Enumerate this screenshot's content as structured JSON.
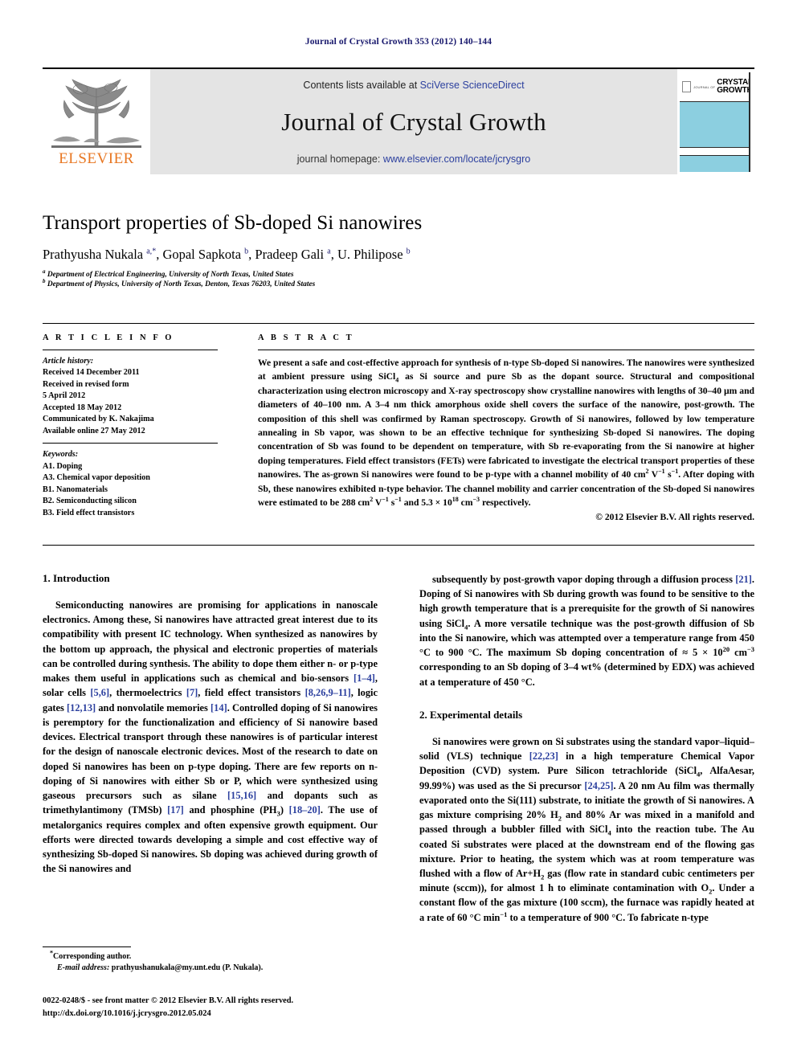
{
  "running_head": "Journal of Crystal Growth 353 (2012) 140–144",
  "masthead": {
    "publisher_logo_text": "ELSEVIER",
    "contents_prefix": "Contents lists available at ",
    "contents_link": "SciVerse ScienceDirect",
    "journal_title": "Journal of Crystal Growth",
    "homepage_prefix": "journal homepage: ",
    "homepage_link": "www.elsevier.com/locate/jcrysgro",
    "cover": {
      "journal_of": "JOURNAL OF",
      "line1": "CRYSTAL",
      "line2": "GROWTH"
    }
  },
  "article": {
    "title": "Transport properties of Sb-doped Si nanowires",
    "authors_html": "Prathyusha Nukala <sup>a,</sup><sup>*</sup>, Gopal Sapkota <sup>b</sup>, Pradeep Gali <sup>a</sup>, U. Philipose <sup>b</sup>",
    "affiliation_a": "Department of Electrical Engineering, University of North Texas, United States",
    "affiliation_b": "Department of Physics, University of North Texas, Denton, Texas 76203, United States"
  },
  "article_info": {
    "heading": "A R T I C L E   I N F O",
    "history_label": "Article history:",
    "history": [
      "Received 14 December 2011",
      "Received in revised form",
      "5 April 2012",
      "Accepted 18 May 2012",
      "Communicated by K. Nakajima",
      "Available online 27 May 2012"
    ],
    "keywords_label": "Keywords:",
    "keywords": [
      "A1. Doping",
      "A3. Chemical vapor deposition",
      "B1. Nanomaterials",
      "B2. Semiconducting silicon",
      "B3. Field effect transistors"
    ]
  },
  "abstract": {
    "heading": "A B S T R A C T",
    "text_html": "We present a safe and cost-effective approach for synthesis of n-type Sb-doped Si nanowires. The nanowires were synthesized at ambient pressure using SiCl<sub>4</sub> as Si source and pure Sb as the dopant source. Structural and compositional characterization using electron microscopy and X-ray spectroscopy show crystalline nanowires with lengths of 30&#8211;40 &#181;m and diameters of 40&#8211;100 nm. A 3&#8211;4 nm thick amorphous oxide shell covers the surface of the nanowire, post-growth. The composition of this shell was confirmed by Raman spectroscopy. Growth of Si nanowires, followed by low temperature annealing in Sb vapor, was shown to be an effective technique for synthesizing Sb-doped Si nanowires. The doping concentration of Sb was found to be dependent on temperature, with Sb re-evaporating from the Si nanowire at higher doping temperatures. Field effect transistors (FETs) were fabricated to investigate the electrical transport properties of these nanowires. The as-grown Si nanowires were found to be p-type with a channel mobility of 40 cm<sup>2</sup> V<sup>&#8722;1</sup> s<sup>&#8722;1</sup>. After doping with Sb, these nanowires exhibited n-type behavior. The channel mobility and carrier concentration of the Sb-doped Si nanowires were estimated to be 288 cm<sup>2</sup> V<sup>&#8722;1</sup> s<sup>&#8722;1</sup> and 5.3 &#215; 10<sup>18</sup> cm<sup>&#8722;3</sup> respectively.",
    "copyright": "&#169; 2012 Elsevier B.V. All rights reserved."
  },
  "sections": {
    "introduction": {
      "heading": "1.  Introduction",
      "paragraph_html": "Semiconducting nanowires are promising for applications in nanoscale electronics. Among these, Si nanowires have attracted great interest due to its compatibility with present IC technology. When synthesized as nanowires by the bottom up approach, the physical and electronic properties of materials can be controlled during synthesis. The ability to dope them either n- or p-type makes them useful in applications such as chemical and bio-sensors <span class=\"ref\">[1&#8211;4]</span>, solar cells <span class=\"ref\">[5,6]</span>, thermoelectrics <span class=\"ref\">[7]</span>, field effect transistors <span class=\"ref\">[8,26,9&#8211;11]</span>, logic gates <span class=\"ref\">[12,13]</span> and nonvolatile memories <span class=\"ref\">[14]</span>. Controlled doping of Si nanowires is peremptory for the functionalization and efficiency of Si nanowire based devices. Electrical transport through these nanowires is of particular interest for the design of nanoscale electronic devices. Most of the research to date on doped Si nanowires has been on p-type doping. There are few reports on n-doping of Si nanowires with either Sb or P, which were synthesized using gaseous precursors such as silane <span class=\"ref\">[15,16]</span> and dopants such as trimethylantimony (TMSb) <span class=\"ref\">[17]</span> and phosphine (PH<sub>3</sub>) <span class=\"ref\">[18&#8211;20]</span>. The use of metalorganics requires complex and often expensive growth equipment. Our efforts were directed towards developing a simple and cost effective way of synthesizing Sb-doped Si nanowires. Sb doping was achieved during growth of the Si nanowires and"
    },
    "introduction_cont": {
      "paragraph_html": "subsequently by post-growth vapor doping through a diffusion process <span class=\"ref\">[21]</span>. Doping of Si nanowires with Sb during growth was found to be sensitive to the high growth temperature that is a prerequisite for the growth of Si nanowires using SiCl<sub>4</sub>. A more versatile technique was the post-growth diffusion of Sb into the Si nanowire, which was attempted over a temperature range from 450 &#176;C to 900 &#176;C. The maximum Sb doping concentration of &#8776; 5 &#215; 10<sup>20</sup> cm<sup>&#8722;3</sup> corresponding to an Sb doping of 3&#8211;4 wt% (determined by EDX) was achieved at a temperature of 450 &#176;C."
    },
    "experimental": {
      "heading": "2.  Experimental details",
      "paragraph_html": "Si nanowires were grown on Si substrates using the standard vapor&#8211;liquid&#8211;solid (VLS) technique <span class=\"ref\">[22,23]</span> in a high temperature Chemical Vapor Deposition (CVD) system. Pure Silicon tetrachloride (SiCl<sub>4</sub>, AlfaAesar, 99.99%) was used as the Si precursor <span class=\"ref\">[24,25]</span>. A 20 nm Au film was thermally evaporated onto the Si(111) substrate, to initiate the growth of Si nanowires. A gas mixture comprising 20% H<sub>2</sub> and 80% Ar was mixed in a manifold and passed through a bubbler filled with SiCl<sub>4</sub> into the reaction tube. The Au coated Si substrates were placed at the downstream end of the flowing gas mixture. Prior to heating, the system which was at room temperature was flushed with a flow of Ar+H<sub>2</sub> gas (flow rate in standard cubic centimeters per minute (sccm)), for almost 1 h to eliminate contamination with O<sub>2</sub>. Under a constant flow of the gas mixture (100 sccm), the furnace was rapidly heated at a rate of 60 &#176;C min<sup>&#8722;1</sup> to a temperature of 900 &#176;C. To fabricate n-type"
    }
  },
  "footnote": {
    "corresponding_author": "Corresponding author.",
    "email_label": "E-mail address:",
    "email": "prathyushanukala@my.unt.edu (P. Nukala)."
  },
  "imprint": {
    "issn_line": "0022-0248/$ - see front matter &#169; 2012 Elsevier B.V. All rights reserved.",
    "doi_line": "http://dx.doi.org/10.1016/j.jcrysgro.2012.05.024"
  },
  "colors": {
    "link": "#2b3f9e",
    "running_head": "#1a1a6e",
    "elsevier_orange": "#E87722",
    "cover_band": "#8ccfe0",
    "masthead_bg": "#e4e4e4"
  }
}
